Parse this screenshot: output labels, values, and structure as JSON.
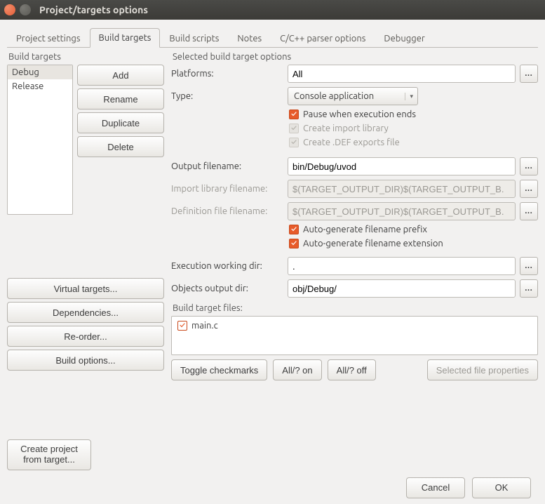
{
  "window": {
    "title": "Project/targets options"
  },
  "tabs": [
    {
      "label": "Project settings"
    },
    {
      "label": "Build targets"
    },
    {
      "label": "Build scripts"
    },
    {
      "label": "Notes"
    },
    {
      "label": "C/C++ parser options"
    },
    {
      "label": "Debugger"
    }
  ],
  "left": {
    "legend": "Build targets",
    "items": [
      {
        "label": "Debug",
        "selected": true
      },
      {
        "label": "Release",
        "selected": false
      }
    ],
    "buttons_top": {
      "add": "Add",
      "rename": "Rename",
      "duplicate": "Duplicate",
      "delete": "Delete"
    },
    "buttons_mid": {
      "virtual": "Virtual targets...",
      "deps": "Dependencies...",
      "reorder": "Re-order...",
      "options": "Build options..."
    },
    "create": "Create project from target..."
  },
  "right": {
    "legend": "Selected build target options",
    "platforms_label": "Platforms:",
    "platforms_value": "All",
    "type_label": "Type:",
    "type_value": "Console application",
    "pause": "Pause when execution ends",
    "importlib": "Create import library",
    "defexports": "Create .DEF exports file",
    "output_label": "Output filename:",
    "output_value": "bin/Debug/uvod",
    "importlib_file_label": "Import library filename:",
    "importlib_file_value": "$(TARGET_OUTPUT_DIR)$(TARGET_OUTPUT_B.",
    "deffile_label": "Definition file filename:",
    "deffile_value": "$(TARGET_OUTPUT_DIR)$(TARGET_OUTPUT_B.",
    "auto_prefix": "Auto-generate filename prefix",
    "auto_ext": "Auto-generate filename extension",
    "exec_dir_label": "Execution working dir:",
    "exec_dir_value": ".",
    "obj_dir_label": "Objects output dir:",
    "obj_dir_value": "obj/Debug/",
    "files_legend": "Build target files:",
    "files": [
      {
        "name": "main.c"
      }
    ],
    "toggle": "Toggle checkmarks",
    "allon": "All/? on",
    "alloff": "All/? off",
    "selprops": "Selected file properties"
  },
  "footer": {
    "cancel": "Cancel",
    "ok": "OK"
  }
}
